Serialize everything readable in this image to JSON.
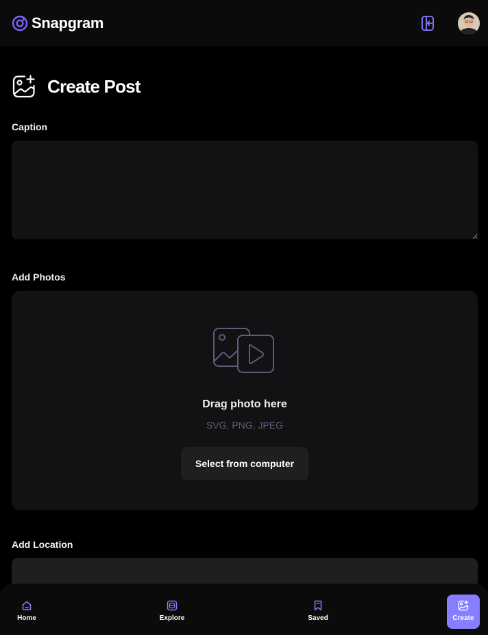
{
  "app": {
    "name": "Snapgram"
  },
  "header": {
    "logout_icon": "logout-icon",
    "avatar": "profile-avatar"
  },
  "page": {
    "title": "Create Post",
    "icon": "gallery-add-icon"
  },
  "form": {
    "caption_label": "Caption",
    "caption_value": "",
    "photos_label": "Add Photos",
    "drag_text": "Drag photo here",
    "formats_text": "SVG, PNG, JPEG",
    "select_button": "Select from computer",
    "location_label": "Add Location",
    "location_value": ""
  },
  "bottom_nav": [
    {
      "label": "Home",
      "icon": "home-icon",
      "active": false
    },
    {
      "label": "Explore",
      "icon": "explore-icon",
      "active": false
    },
    {
      "label": "Saved",
      "icon": "bookmark-icon",
      "active": false
    },
    {
      "label": "Create",
      "icon": "gallery-add-icon",
      "active": true
    }
  ],
  "colors": {
    "accent": "#877eff",
    "background": "#000000",
    "surface": "#121214",
    "muted": "#5c5c7b"
  }
}
